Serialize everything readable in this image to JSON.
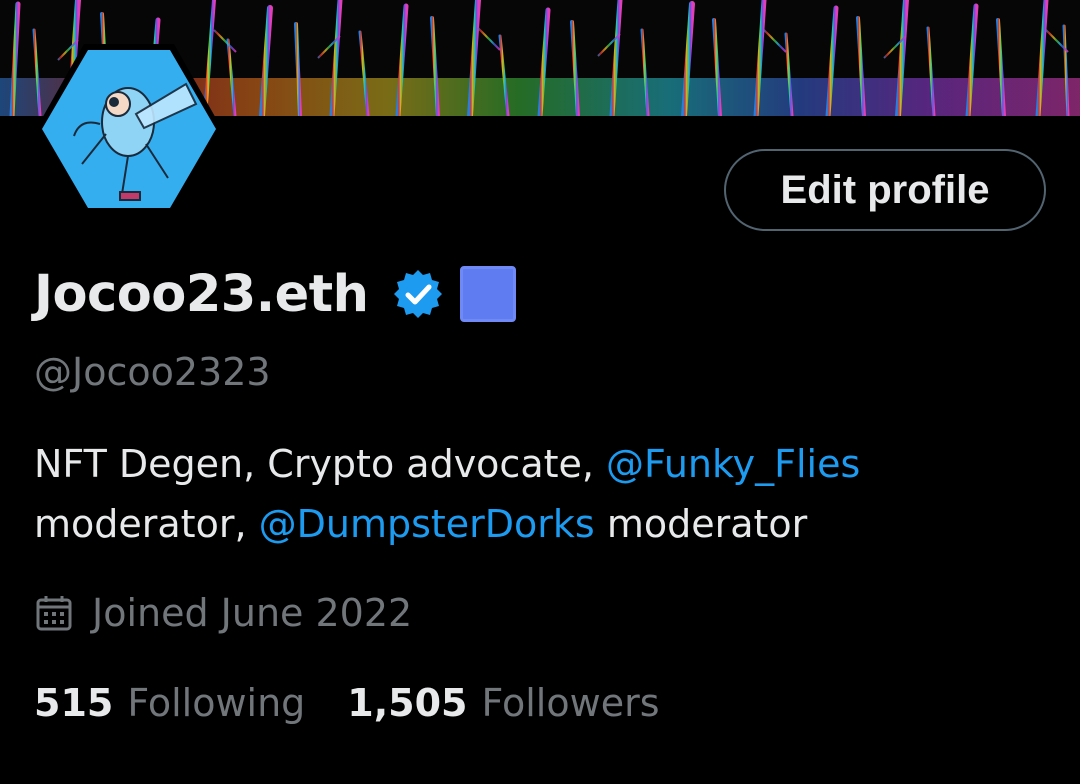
{
  "banner": {
    "icon": "rainbow-forest-banner"
  },
  "avatar": {
    "icon": "cartoon-fly-avatar-icon",
    "bg_color": "#35aef0"
  },
  "edit_profile": {
    "label": "Edit profile"
  },
  "profile": {
    "display_name": "Jocoo23.eth",
    "verified_icon": "verified-badge-icon",
    "verified_color": "#1d9bf0",
    "affiliation_icon": "affiliation-square-icon",
    "affiliation_color": "#5f7cf0",
    "handle": "@Jocoo2323"
  },
  "bio": {
    "part1": "NFT Degen, Crypto advocate, ",
    "mention1": "@Funky_Flies",
    "part2": " moderator, ",
    "mention2": "@DumpsterDorks",
    "part3": " moderator",
    "mention_color": "#1d9bf0"
  },
  "joined": {
    "icon": "calendar-icon",
    "text": "Joined June 2022"
  },
  "stats": {
    "following_count": "515",
    "following_label": "Following",
    "followers_count": "1,505",
    "followers_label": "Followers"
  }
}
